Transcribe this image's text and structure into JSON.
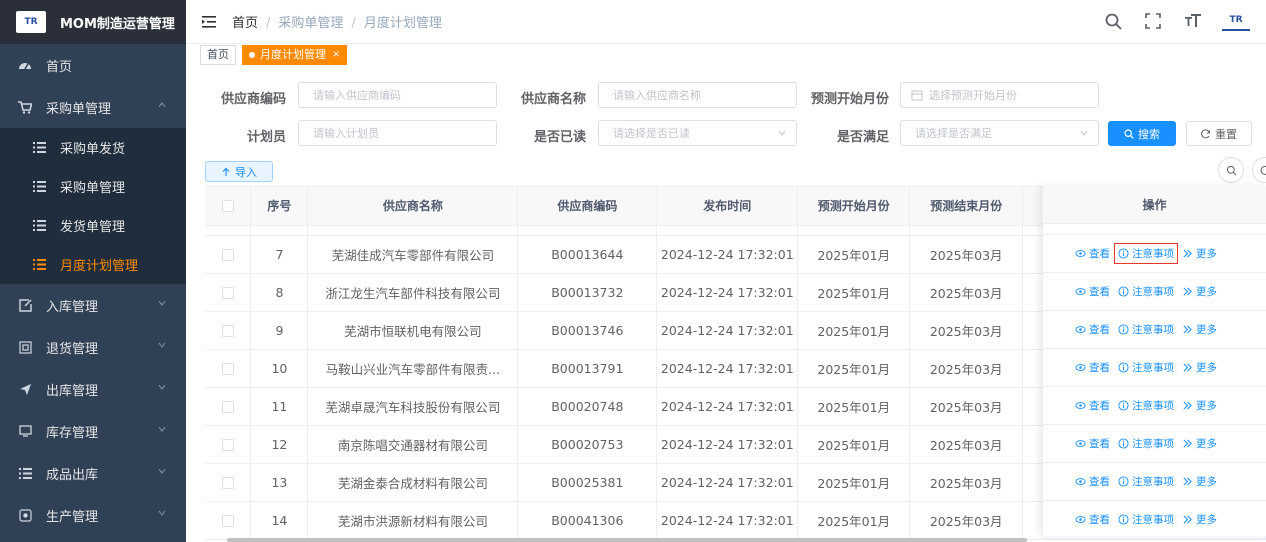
{
  "app": {
    "title": "MOM制造运营管理",
    "logo_text": "TR"
  },
  "sidebar": {
    "items": [
      {
        "label": "首页",
        "icon": "dashboard-icon"
      },
      {
        "label": "采购单管理",
        "icon": "cart-icon",
        "expanded": true,
        "children": [
          {
            "label": "采购单发货",
            "icon": "list-icon"
          },
          {
            "label": "采购单管理",
            "icon": "list-icon"
          },
          {
            "label": "发货单管理",
            "icon": "list-icon"
          },
          {
            "label": "月度计划管理",
            "icon": "list-icon",
            "active": true
          }
        ]
      },
      {
        "label": "入库管理",
        "icon": "edit-icon"
      },
      {
        "label": "退货管理",
        "icon": "return-icon"
      },
      {
        "label": "出库管理",
        "icon": "send-icon"
      },
      {
        "label": "库存管理",
        "icon": "monitor-icon"
      },
      {
        "label": "成品出库",
        "icon": "list-icon"
      },
      {
        "label": "生产管理",
        "icon": "production-icon"
      }
    ]
  },
  "breadcrumb": {
    "home": "首页",
    "level1": "采购单管理",
    "level2": "月度计划管理"
  },
  "tags": {
    "home": "首页",
    "active": "月度计划管理",
    "close": "×"
  },
  "search": {
    "supplier_code": {
      "label": "供应商编码",
      "placeholder": "请输入供应商编码"
    },
    "supplier_name": {
      "label": "供应商名称",
      "placeholder": "请输入供应商名称"
    },
    "forecast_start": {
      "label": "预测开始月份",
      "placeholder": "选择预测开始月份"
    },
    "planner": {
      "label": "计划员",
      "placeholder": "请输入计划员"
    },
    "is_read": {
      "label": "是否已读",
      "placeholder": "请选择是否已读"
    },
    "is_satisfied": {
      "label": "是否满足",
      "placeholder": "请选择是否满足"
    },
    "search_btn": "搜索",
    "reset_btn": "重置"
  },
  "toolbar": {
    "import_btn": "导入"
  },
  "table": {
    "columns": [
      "序号",
      "供应商名称",
      "供应商编码",
      "发布时间",
      "预测开始月份",
      "预测结束月份",
      "操作"
    ],
    "rows": [
      {
        "no": "7",
        "name": "芜湖佳成汽车零部件有限公司",
        "code": "B00013644",
        "time": "2024-12-24 17:32:01",
        "start": "2025年01月",
        "end": "2025年03月"
      },
      {
        "no": "8",
        "name": "浙江龙生汽车部件科技有限公司",
        "code": "B00013732",
        "time": "2024-12-24 17:32:01",
        "start": "2025年01月",
        "end": "2025年03月"
      },
      {
        "no": "9",
        "name": "芜湖市恒联机电有限公司",
        "code": "B00013746",
        "time": "2024-12-24 17:32:01",
        "start": "2025年01月",
        "end": "2025年03月"
      },
      {
        "no": "10",
        "name": "马鞍山兴业汽车零部件有限责...",
        "code": "B00013791",
        "time": "2024-12-24 17:32:01",
        "start": "2025年01月",
        "end": "2025年03月"
      },
      {
        "no": "11",
        "name": "芜湖卓晟汽车科技股份有限公司",
        "code": "B00020748",
        "time": "2024-12-24 17:32:01",
        "start": "2025年01月",
        "end": "2025年03月"
      },
      {
        "no": "12",
        "name": "南京陈唱交通器材有限公司",
        "code": "B00020753",
        "time": "2024-12-24 17:32:01",
        "start": "2025年01月",
        "end": "2025年03月"
      },
      {
        "no": "13",
        "name": "芜湖金泰合成材料有限公司",
        "code": "B00025381",
        "time": "2024-12-24 17:32:01",
        "start": "2025年01月",
        "end": "2025年03月"
      },
      {
        "no": "14",
        "name": "芜湖市洪源新材料有限公司",
        "code": "B00041306",
        "time": "2024-12-24 17:32:01",
        "start": "2025年01月",
        "end": "2025年03月"
      }
    ],
    "actions": {
      "view": "查看",
      "notes": "注意事项",
      "more": "更多"
    }
  },
  "colors": {
    "accent": "#ff8a00",
    "primary": "#1890ff",
    "sidebar_bg": "#304156",
    "highlight_border": "#e5382d"
  }
}
